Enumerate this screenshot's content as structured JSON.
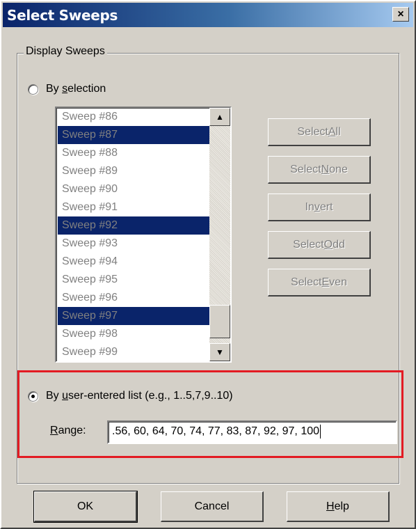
{
  "window": {
    "title": "Select Sweeps",
    "close_symbol": "×"
  },
  "group": {
    "title": "Display Sweeps"
  },
  "by_selection": {
    "label_pre": "By ",
    "label_accel": "s",
    "label_post": "election",
    "checked": false
  },
  "sweeps": [
    {
      "label": "Sweep #86",
      "selected": false
    },
    {
      "label": "Sweep #87",
      "selected": true
    },
    {
      "label": "Sweep #88",
      "selected": false
    },
    {
      "label": "Sweep #89",
      "selected": false
    },
    {
      "label": "Sweep #90",
      "selected": false
    },
    {
      "label": "Sweep #91",
      "selected": false
    },
    {
      "label": "Sweep #92",
      "selected": true
    },
    {
      "label": "Sweep #93",
      "selected": false
    },
    {
      "label": "Sweep #94",
      "selected": false
    },
    {
      "label": "Sweep #95",
      "selected": false
    },
    {
      "label": "Sweep #96",
      "selected": false
    },
    {
      "label": "Sweep #97",
      "selected": true
    },
    {
      "label": "Sweep #98",
      "selected": false
    },
    {
      "label": "Sweep #99",
      "selected": false
    }
  ],
  "side_buttons": [
    {
      "pre": "Select ",
      "accel": "A",
      "post": "ll"
    },
    {
      "pre": "Select ",
      "accel": "N",
      "post": "one"
    },
    {
      "pre": "In",
      "accel": "v",
      "post": "ert"
    },
    {
      "pre": "Select ",
      "accel": "O",
      "post": "dd"
    },
    {
      "pre": "Select ",
      "accel": "E",
      "post": "ven"
    }
  ],
  "by_list": {
    "label_pre": "By ",
    "label_accel": "u",
    "label_post": "ser-entered list  (e.g., 1..5,7,9..10)",
    "checked": true,
    "range_accel": "R",
    "range_post": "ange:",
    "range_value": ".56, 60, 64, 70, 74, 77, 83, 87, 92, 97, 100"
  },
  "buttons": {
    "ok": "OK",
    "cancel": "Cancel",
    "help_accel": "H",
    "help_post": "elp"
  },
  "colors": {
    "highlight_border": "#e31b23",
    "selection_bg": "#0a246a"
  }
}
